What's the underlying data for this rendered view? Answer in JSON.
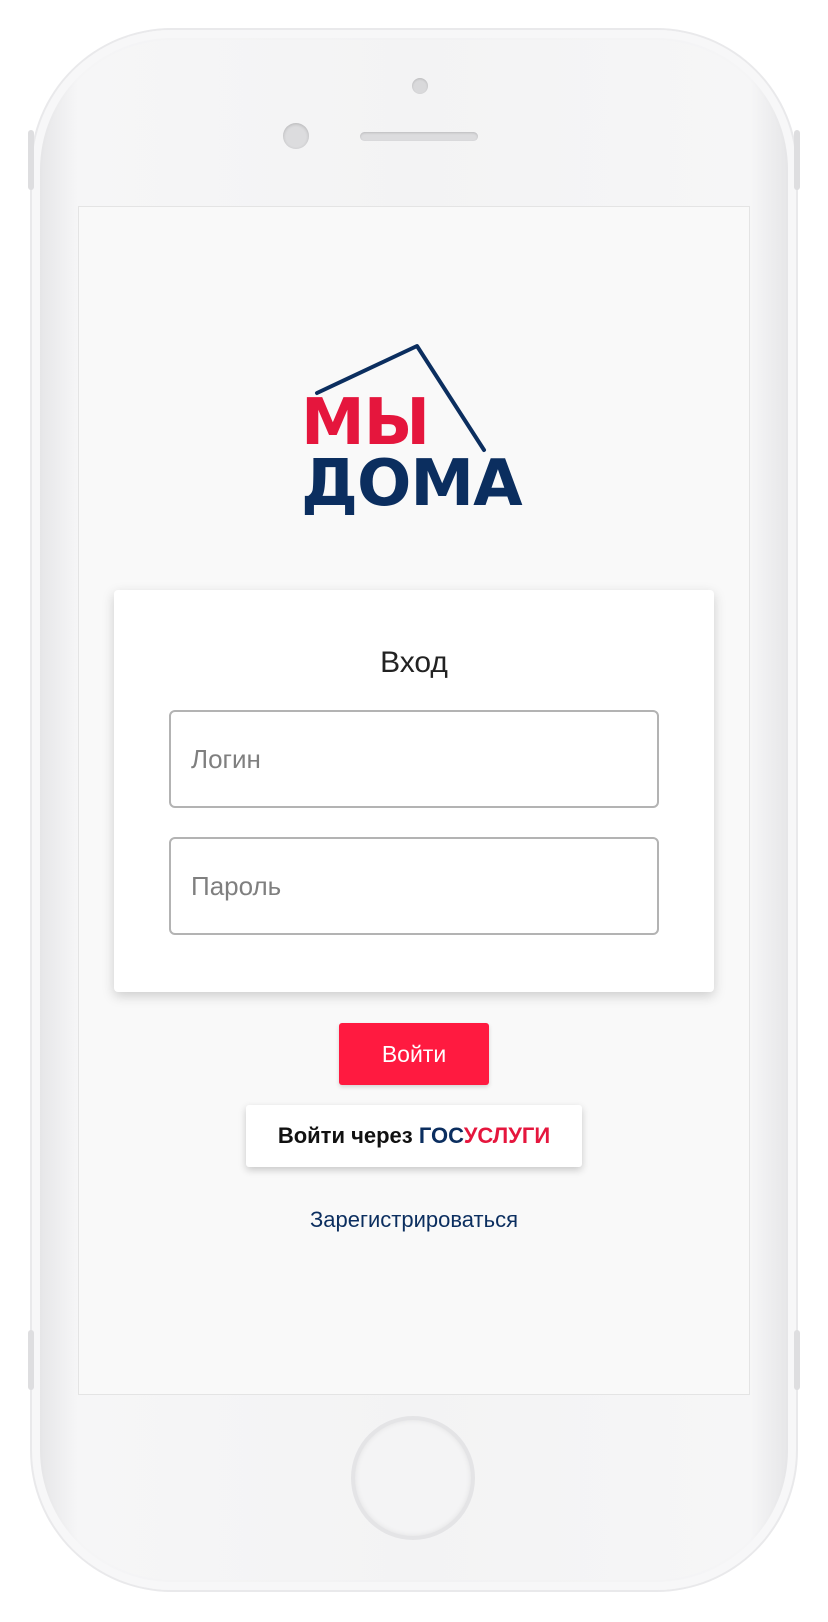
{
  "logo": {
    "line1": "МЫ",
    "line2": "ДОМА"
  },
  "login_card": {
    "title": "Вход",
    "login_placeholder": "Логин",
    "password_placeholder": "Пароль"
  },
  "actions": {
    "login_button": "Войти",
    "gosuslugi_prefix": "Войти через ",
    "gosuslugi_part1": "ГОС",
    "gosuslugi_part2": "УСЛУГИ",
    "register_link": "Зарегистрироваться"
  },
  "colors": {
    "brand_red": "#e5163d",
    "brand_navy": "#0b2e5f",
    "button_red": "#ff1a40",
    "screen_bg": "#f9f9f9"
  }
}
